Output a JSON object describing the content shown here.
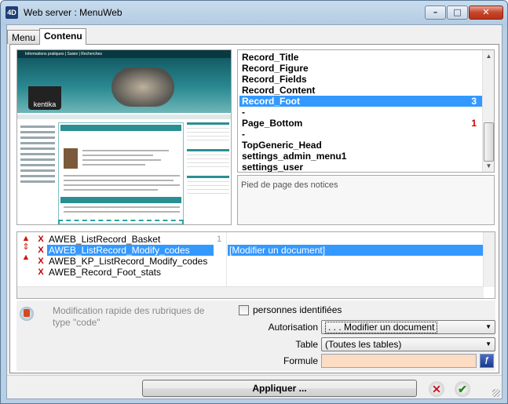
{
  "window": {
    "title": "Web server : MenuWeb",
    "app_icon": "4D",
    "minimize_glyph": "–",
    "maximize_glyph": "□",
    "close_glyph": "✕"
  },
  "tabs": [
    {
      "label": "Menu",
      "active": false
    },
    {
      "label": "Contenu",
      "active": true
    }
  ],
  "preview": {
    "icon": "web-page-preview-thumbnail",
    "topbar_text": "Informations pratiques | Saisie | Recherches",
    "logo_text": "kentika"
  },
  "record_list": {
    "items": [
      {
        "label": "Record_Title",
        "count": ""
      },
      {
        "label": "Record_Figure",
        "count": ""
      },
      {
        "label": "Record_Fields",
        "count": ""
      },
      {
        "label": "Record_Content",
        "count": ""
      },
      {
        "label": "Record_Foot",
        "count": "3",
        "selected": true
      },
      {
        "label": "-",
        "count": ""
      },
      {
        "label": "Page_Bottom",
        "count": "1"
      },
      {
        "label": "-",
        "count": ""
      },
      {
        "label": "TopGeneric_Head",
        "count": ""
      },
      {
        "label": "settings_admin_menu1",
        "count": ""
      },
      {
        "label": "settings_user",
        "count": ""
      }
    ],
    "selected_color": "#3399ff",
    "count_color": "#d40000"
  },
  "notes": {
    "text": "Pied de page des notices"
  },
  "methods": {
    "rows": [
      {
        "remove": "X",
        "name": "AWEB_ListRecord_Basket",
        "index": "1",
        "value": ""
      },
      {
        "remove": "X",
        "name": "AWEB_ListRecord_Modify_codes",
        "index": "",
        "value": "[Modifier un document]",
        "selected": true
      },
      {
        "remove": "X",
        "name": "AWEB_KP_ListRecord_Modify_codes",
        "index": "",
        "value": ""
      },
      {
        "remove": "X",
        "name": "AWEB_Record_Foot_stats",
        "index": "",
        "value": ""
      }
    ],
    "move_up_icon": "red-up-arrow-icon",
    "move_updown_icon": "red-up-down-arrow-icon"
  },
  "form": {
    "description": "Modification rapide des rubriques de type \"code\"",
    "checkbox_label": "personnes identifiées",
    "checkbox_checked": false,
    "autorisation_label": "Autorisation",
    "autorisation_value": ". . . Modifier un document",
    "table_label": "Table",
    "table_value": "(Toutes les tables)",
    "formule_label": "Formule",
    "formule_value": "",
    "formule_field_color": "#fcdcc2"
  },
  "footer": {
    "apply_label": "Appliquer ...",
    "cancel_glyph": "✕",
    "ok_glyph": "✔"
  }
}
